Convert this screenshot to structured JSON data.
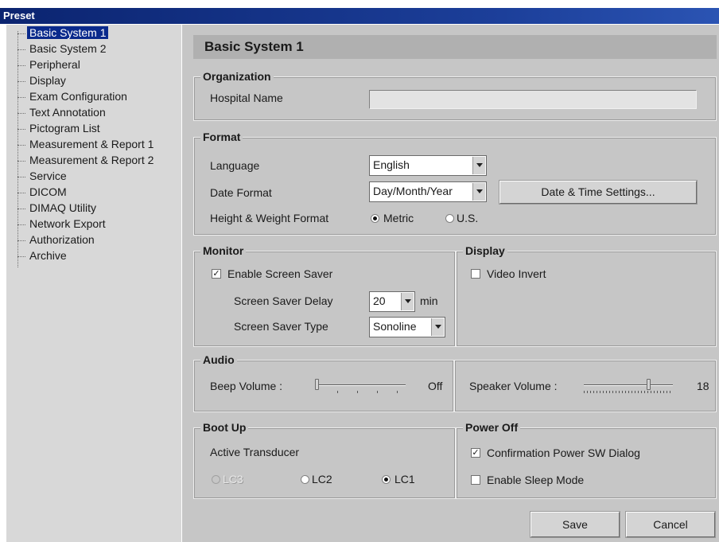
{
  "window": {
    "title": "Preset"
  },
  "tree": {
    "items": [
      {
        "label": "Basic System 1",
        "selected": true
      },
      {
        "label": "Basic System 2"
      },
      {
        "label": "Peripheral"
      },
      {
        "label": "Display"
      },
      {
        "label": "Exam Configuration"
      },
      {
        "label": "Text Annotation"
      },
      {
        "label": "Pictogram List"
      },
      {
        "label": "Measurement & Report 1"
      },
      {
        "label": "Measurement & Report 2"
      },
      {
        "label": "Service"
      },
      {
        "label": "DICOM"
      },
      {
        "label": "DIMAQ Utility"
      },
      {
        "label": "Network Export"
      },
      {
        "label": "Authorization"
      },
      {
        "label": "Archive"
      }
    ]
  },
  "page": {
    "title": "Basic System 1"
  },
  "organization": {
    "title": "Organization",
    "hospital_name_label": "Hospital Name",
    "hospital_name_value": ""
  },
  "format": {
    "title": "Format",
    "language_label": "Language",
    "language_value": "English",
    "date_format_label": "Date Format",
    "date_format_value": "Day/Month/Year",
    "date_time_button": "Date & Time Settings...",
    "hw_format_label": "Height & Weight Format",
    "hw_options": [
      {
        "label": "Metric",
        "selected": true
      },
      {
        "label": "U.S.",
        "selected": false
      }
    ]
  },
  "monitor": {
    "title": "Monitor",
    "screen_saver_label": "Enable Screen Saver",
    "screen_saver_checked": true,
    "delay_label": "Screen Saver Delay",
    "delay_value": "20",
    "delay_unit": "min",
    "type_label": "Screen Saver Type",
    "type_value": "Sonoline"
  },
  "display": {
    "title": "Display",
    "video_invert_label": "Video Invert",
    "video_invert_checked": false
  },
  "audio": {
    "title": "Audio",
    "beep_label": "Beep Volume :",
    "beep_value": "Off",
    "beep_level": 0,
    "speaker_label": "Speaker Volume :",
    "speaker_value": "18",
    "speaker_level": 0.72
  },
  "bootup": {
    "title": "Boot Up",
    "active_transducer_label": "Active Transducer",
    "options": [
      {
        "label": "LC3",
        "selected": false,
        "disabled": true
      },
      {
        "label": "LC2",
        "selected": false,
        "disabled": false
      },
      {
        "label": "LC1",
        "selected": true,
        "disabled": false
      }
    ]
  },
  "poweroff": {
    "title": "Power Off",
    "confirm_label": "Confirmation Power SW Dialog",
    "confirm_checked": true,
    "sleep_label": "Enable Sleep Mode",
    "sleep_checked": false
  },
  "actions": {
    "save": "Save",
    "cancel": "Cancel"
  }
}
